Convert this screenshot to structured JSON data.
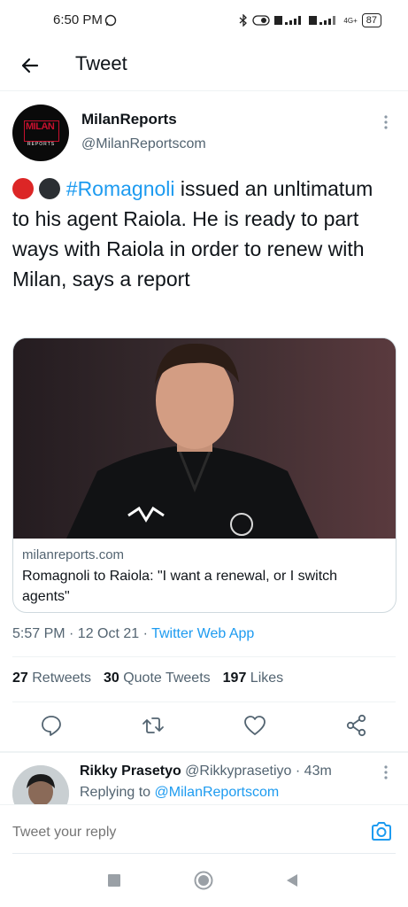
{
  "status_bar": {
    "time": "6:50 PM",
    "network": "4G+",
    "battery": "87"
  },
  "header": {
    "title": "Tweet"
  },
  "tweet": {
    "author_name": "MilanReports",
    "author_handle": "@MilanReportscom",
    "avatar_logo_text": "MILAN",
    "avatar_logo_sub": "REPORTS",
    "hashtag": "#Romagnoli",
    "body": " issued an unltimatum to his agent Raiola. He is ready to part ways with Raiola in order to renew with Milan, says a report",
    "emoji_colors": [
      "#dc2626",
      "#2b2f33"
    ],
    "card": {
      "domain": "milanreports.com",
      "title": "Romagnoli to Raiola: \"I want a renewal, or I switch agents\""
    },
    "timestamp": "5:57 PM · 12 Oct 21 · ",
    "source": "Twitter Web App",
    "stats": {
      "retweets_count": "27",
      "retweets_label": "Retweets",
      "quotes_count": "30",
      "quotes_label": "Quote Tweets",
      "likes_count": "197",
      "likes_label": "Likes"
    }
  },
  "reply": {
    "name": "Rikky Prasetyo",
    "handle_time": " @Rikkyprasetiyo · 43m",
    "replying_prefix": "Replying to ",
    "replying_to": "@MilanReportscom"
  },
  "composer": {
    "placeholder": "Tweet your reply"
  },
  "colors": {
    "accent": "#1d9bf0",
    "text": "#0f1419",
    "muted": "#536471"
  }
}
